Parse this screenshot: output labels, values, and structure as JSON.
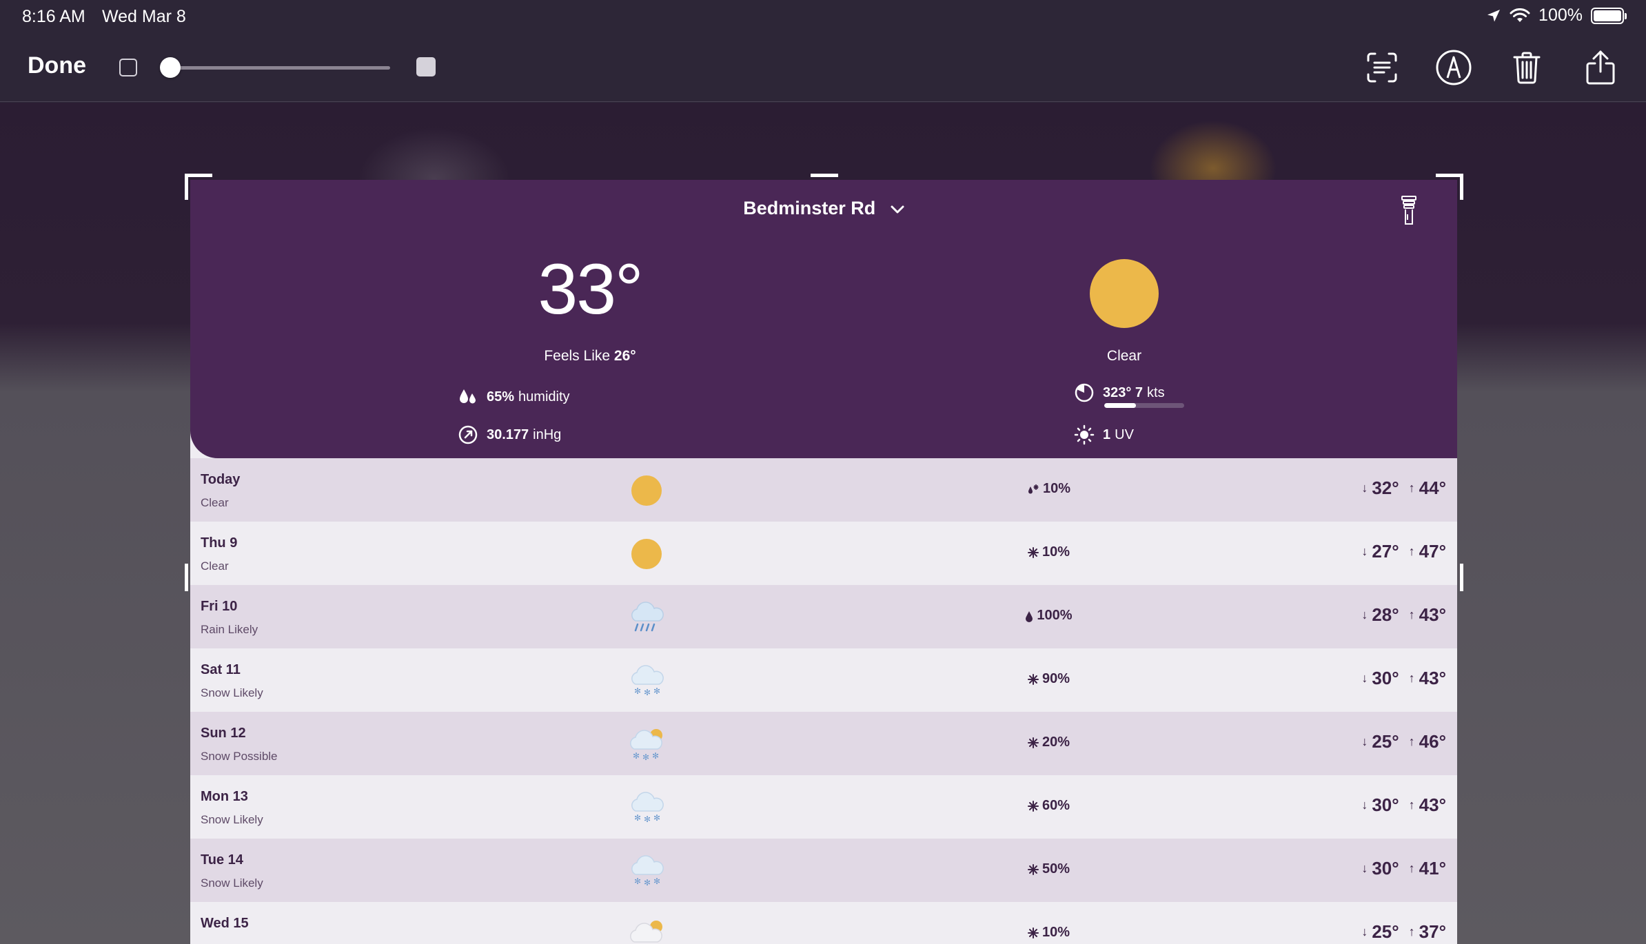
{
  "status_bar": {
    "time": "8:16 AM",
    "date": "Wed Mar 8",
    "battery": "100%"
  },
  "toolbar": {
    "done_label": "Done"
  },
  "weather": {
    "location": "Bedminster Rd",
    "temperature": "33°",
    "feels_like_label": "Feels Like",
    "feels_like_value": "26°",
    "humidity_value": "65%",
    "humidity_label": "humidity",
    "pressure_value": "30.177",
    "pressure_unit": "inHg",
    "condition": "Clear",
    "wind_value": "323° 7",
    "wind_unit": "kts",
    "wind_level": 0.4,
    "uv_value": "1",
    "uv_label": "UV"
  },
  "forecast": [
    {
      "day": "Today",
      "condition": "Clear",
      "icon": "sun-icon",
      "precip_icon": "rain-snow-icon",
      "precip": "10%",
      "low": "32°",
      "high": "44°"
    },
    {
      "day": "Thu 9",
      "condition": "Clear",
      "icon": "sun-icon",
      "precip_icon": "snowflake-icon",
      "precip": "10%",
      "low": "27°",
      "high": "47°"
    },
    {
      "day": "Fri 10",
      "condition": "Rain Likely",
      "icon": "rain-cloud-icon",
      "precip_icon": "raindrop-icon",
      "precip": "100%",
      "low": "28°",
      "high": "43°"
    },
    {
      "day": "Sat 11",
      "condition": "Snow Likely",
      "icon": "snow-cloud-icon",
      "precip_icon": "snowflake-icon",
      "precip": "90%",
      "low": "30°",
      "high": "43°"
    },
    {
      "day": "Sun 12",
      "condition": "Snow Possible",
      "icon": "snow-partly-sunny-icon",
      "precip_icon": "snowflake-icon",
      "precip": "20%",
      "low": "25°",
      "high": "46°"
    },
    {
      "day": "Mon 13",
      "condition": "Snow Likely",
      "icon": "snow-cloud-icon",
      "precip_icon": "snowflake-icon",
      "precip": "60%",
      "low": "30°",
      "high": "43°"
    },
    {
      "day": "Tue 14",
      "condition": "Snow Likely",
      "icon": "snow-cloud-icon",
      "precip_icon": "snowflake-icon",
      "precip": "50%",
      "low": "30°",
      "high": "41°"
    },
    {
      "day": "Wed 15",
      "condition": "",
      "icon": "partly-sunny-icon",
      "precip_icon": "snowflake-icon",
      "precip": "10%",
      "low": "25°",
      "high": "37°"
    }
  ],
  "colors": {
    "hero_purple": "#4a2756",
    "sun_yellow": "#ecb84a",
    "row_alt": "#e1d9e5",
    "row_base": "#efedf2",
    "text_dark": "#3c2346"
  }
}
